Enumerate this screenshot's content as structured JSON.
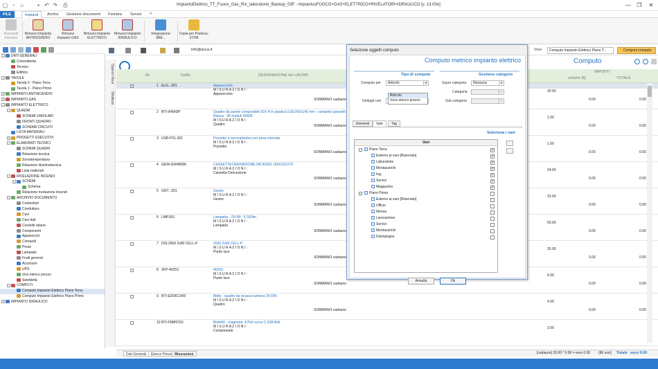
{
  "window": {
    "title": "ImpiantoElettrico_TT_Fuoco_Gas_Riv_laboratorio_Backup_03F - ImpiantusFUOCO+GAS+ELETTRICO+RIVELATORI+IDRAULICO [v. 13.00e]",
    "controls": [
      "—",
      "❐",
      "✕"
    ]
  },
  "menu": {
    "file": "FILE",
    "items": [
      "Impianti",
      "Archivi",
      "Gestione documenti",
      "Finestra",
      "Servizi",
      "?"
    ]
  },
  "ribbon": {
    "buttons": [
      {
        "label": "Nascondi treeview",
        "enabled": false
      },
      {
        "label": "Rimuovi Impianto ANTINCENDIO",
        "enabled": true
      },
      {
        "label": "Rimuovi Impianto GAS",
        "enabled": true
      },
      {
        "label": "Rimuovi Impianto ELETTRICO",
        "enabled": true
      },
      {
        "label": "Rimuovi Impianto IDRAULICO",
        "enabled": true
      },
      {
        "label": "Integrazione BIM...",
        "enabled": true
      },
      {
        "label": "Copia per Praticus-37/08",
        "enabled": true
      }
    ]
  },
  "tree": [
    {
      "level": 0,
      "label": "DATI GENERALI",
      "exp": "-"
    },
    {
      "level": 1,
      "label": "Committente"
    },
    {
      "level": 1,
      "label": "Tecnico"
    },
    {
      "level": 1,
      "label": "Edificio"
    },
    {
      "level": 0,
      "label": "TAVOLE",
      "exp": "-"
    },
    {
      "level": 1,
      "label": "Tavola 0 - Piano Terra"
    },
    {
      "level": 1,
      "label": "Tavola 1 - Piano Primo"
    },
    {
      "level": 0,
      "label": "IMPIANTO ANTINCENDIO",
      "exp": "+"
    },
    {
      "level": 0,
      "label": "IMPIANTO GAS",
      "exp": "+"
    },
    {
      "level": 0,
      "label": "IMPIANTO ELETTRICO",
      "exp": "-"
    },
    {
      "level": 1,
      "label": "QUADRI",
      "exp": "-"
    },
    {
      "level": 2,
      "label": "SCHEMI UNIFILARI"
    },
    {
      "level": 2,
      "label": "FRONTI QUADRO"
    },
    {
      "level": 2,
      "label": "SCHEMA CIRCUITI"
    },
    {
      "level": 1,
      "label": "LISTA MATERIALI"
    },
    {
      "level": 1,
      "label": "PROGETTI ESECUTIVI",
      "exp": "+"
    },
    {
      "level": 1,
      "label": "ELABORATI TECNICI",
      "exp": "-"
    },
    {
      "level": 2,
      "label": "SCHEMI QUADRI"
    },
    {
      "level": 2,
      "label": "Relazione tecnica"
    },
    {
      "level": 2,
      "label": "Sovratemperatura"
    },
    {
      "level": 2,
      "label": "Relazione illuminotecnica"
    },
    {
      "level": 2,
      "label": "Lista materiali"
    },
    {
      "level": 1,
      "label": "RIVELAZIONE INCENDI",
      "exp": "-"
    },
    {
      "level": 2,
      "label": "SCHEMI",
      "exp": "-"
    },
    {
      "level": 3,
      "label": "Schema"
    },
    {
      "level": 2,
      "label": "Relazione rivelazione incendi"
    },
    {
      "level": 1,
      "label": "ARCHIVIO DOCUMENTO",
      "exp": "-"
    },
    {
      "level": 2,
      "label": "Contenitori"
    },
    {
      "level": 2,
      "label": "Condutture"
    },
    {
      "level": 2,
      "label": "Cavi"
    },
    {
      "level": 2,
      "label": "Cavi dati"
    },
    {
      "level": 2,
      "label": "Condotti sbarre"
    },
    {
      "level": 2,
      "label": "Componenti"
    },
    {
      "level": 2,
      "label": "Apparecchi"
    },
    {
      "level": 2,
      "label": "Comandi"
    },
    {
      "level": 2,
      "label": "Prese"
    },
    {
      "level": 2,
      "label": "Lampade"
    },
    {
      "level": 2,
      "label": "Frutti generici"
    },
    {
      "level": 2,
      "label": "Accessori"
    },
    {
      "level": 2,
      "label": "UPS"
    },
    {
      "level": 2,
      "label": "Voci elenco prezzo"
    },
    {
      "level": 2,
      "label": "Selettività"
    },
    {
      "level": 1,
      "label": "COMPUTI",
      "exp": "-"
    },
    {
      "level": 2,
      "label": "Computo Impianto Elettrico Piano Terra"
    },
    {
      "level": 2,
      "label": "Computo Impianto Elettrico Piano Primo"
    },
    {
      "level": 0,
      "label": "IMPIANTO IDRAULICO",
      "exp": "+"
    }
  ],
  "vtabs": [
    "Opzioni Voce",
    "Struttura"
  ],
  "maintoolbar": {
    "email": "info@acca.it",
    "riferimento_label": "Voce",
    "riferimento_value": "Computo Impianto Elettrico Piano T...",
    "componi": "Componi computo"
  },
  "grid": {
    "title": "Computo",
    "headers": {
      "nr": "Nr.",
      "tariffa": "Tariffa",
      "designazione": "DESIGNAZIONE dei LAVORI",
      "importi": "IMPORTI",
      "unitario": "unitario [€]",
      "totale": "TOTALE"
    },
    "rows": [
      {
        "nr": "1",
        "tariffa": "ELG...001",
        "desc": "Apparecchio",
        "sub": "Apparecchio",
        "qty": "20.00",
        "unit": "0.00",
        "tot": "0.00"
      },
      {
        "nr": "2",
        "tariffa": "BTI-9454DP",
        "desc": "Quadro da parete componibile IDX-P in plastica 515x700x145 mm - completo pannelli di finitura - 96 moduli DIN35",
        "sub": "Quadro",
        "qty": "1.00",
        "unit": "0.00",
        "tot": "0.00"
      },
      {
        "nr": "3",
        "tariffa": "USR-PZL.001",
        "desc": "Pozzetto in termoplastico per posa interrata",
        "sub": "Pozzetto",
        "qty": "1.00",
        "unit": "0.00",
        "tot": "0.00"
      },
      {
        "nr": "4",
        "tariffa": "GEW-GW48006",
        "desc": "CASSETTA DERIVAZIONE INCASSO 196X152X70",
        "sub": "Cassetta Derivazione",
        "qty": "24.00",
        "unit": "0.00",
        "tot": "0.00"
      },
      {
        "nr": "5",
        "tariffa": "GNT...001",
        "desc": "Giunto",
        "sub": "Giunto",
        "qty": "31.00",
        "unit": "0.00",
        "tot": "0.00"
      },
      {
        "nr": "6",
        "tariffa": "LMP.001",
        "desc": "Lampada - 78.0W - 6 550lm",
        "sub": "Lampada",
        "qty": "50.00",
        "unit": "0.00",
        "tot": "0.00"
      },
      {
        "nr": "7",
        "tariffa": "DIS-2656 2x80 CELL-P",
        "desc": "2656 2x80 CELL-P",
        "sub": "Punto luce",
        "qty": "25.00",
        "unit": "0.00",
        "tot": "0.00"
      },
      {
        "nr": "8",
        "tariffa": "3FP-46253",
        "desc": "46253",
        "sub": "Punto luce",
        "qty": "6.00",
        "unit": "0.00",
        "tot": "0.00"
      },
      {
        "nr": "9",
        "tariffa": "BTI-E209C/24D",
        "desc": "Btdin - quadro da incasso lamiera 24 DIN",
        "sub": "Quadro",
        "qty": "4.00",
        "unit": "0.00",
        "tot": "0.00"
      },
      {
        "nr": "10",
        "tariffa": "BTI-FN8HC63",
        "desc": "Btdin60 - magnetot. 4 Poli curva C 63A 6kA",
        "sub": "Componente",
        "qty": "2.00",
        "unit": "",
        "tot": ""
      }
    ],
    "misurazioni_label": "M I S U R A Z I O N I :",
    "sommano_label": "SOMMANO cadauno",
    "sommano_qtys": [
      "20.00",
      "1.00",
      "1.00",
      "24.00",
      "31.00",
      "50.00",
      "25.00",
      "6.00",
      "4.00"
    ]
  },
  "bottom": {
    "tabs": [
      "Dati Generali",
      "Elenco Prezzi",
      "Misurazioni"
    ],
    "status": "[cadauno] 20.00 * 0.00 = euro 0.00",
    "status2": "(86 voci)",
    "totale_label": "Totale",
    "totale_value": "euro 0.00"
  },
  "dialog": {
    "title": "Selezione oggetti computo",
    "header": "Computo metrico impianto elettrico",
    "tipo_section": "Tipo di computo",
    "gestione_section": "Gestione categorie",
    "computo_per_label": "Computo per",
    "computo_per_value": "Articolo",
    "dropdown_options": [
      "Articolo",
      "Voce elenco prezzo"
    ],
    "dettagli_label": "Dettagli cavi",
    "dettagli_value": "No",
    "super_label": "Super categoria",
    "super_value": "Nessuna",
    "categoria_label": "Categoria",
    "subcat_label": "Sub categoria",
    "tabs": [
      "Elementi",
      "Vani",
      "Tag"
    ],
    "seleziona_vani": "Seleziona i vani",
    "vani_header": "Vani",
    "vani": [
      {
        "label": "Piano Terra",
        "group": true,
        "checked": true
      },
      {
        "label": "Esterno ai vani [Riservato]",
        "checked": true
      },
      {
        "label": "Laboratorio",
        "checked": true
      },
      {
        "label": "Montacarichi",
        "checked": true
      },
      {
        "label": "Ing.",
        "checked": true
      },
      {
        "label": "Servizi",
        "checked": true
      },
      {
        "label": "Magazzino",
        "checked": true
      },
      {
        "label": "Piano Primo",
        "group": true,
        "checked": false
      },
      {
        "label": "Esterno ai vani [Riservato]",
        "checked": false
      },
      {
        "label": "Ufficio",
        "checked": false
      },
      {
        "label": "Mensa",
        "checked": false
      },
      {
        "label": "Lavorazione",
        "checked": false
      },
      {
        "label": "Servizi",
        "checked": false
      },
      {
        "label": "Montacarichi",
        "checked": false
      },
      {
        "label": "Disimpegno",
        "checked": false
      }
    ],
    "annulla": "Annulla",
    "ok": "Ok"
  },
  "colors": {
    "accent": "#2474c2",
    "grid_header": "#e3efdc",
    "status_bar": "#2d7ad0",
    "compose_btn": "#f4c25a"
  }
}
